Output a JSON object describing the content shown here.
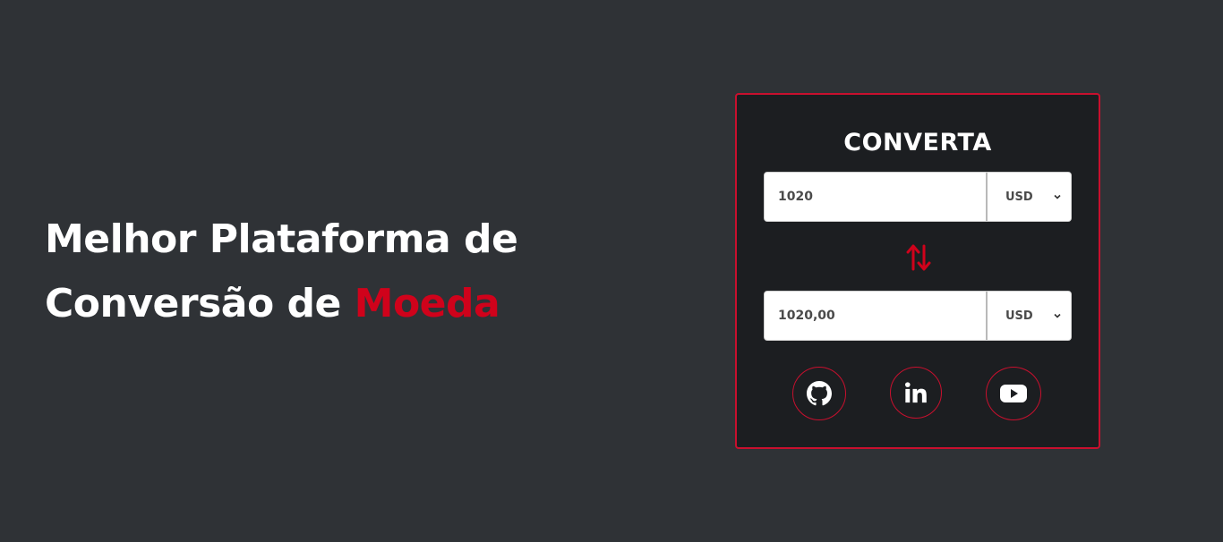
{
  "hero": {
    "line1": "Melhor Plataforma de",
    "line2_prefix": "Conversão de ",
    "line2_accent": "Moeda"
  },
  "converter": {
    "title": "CONVERTA",
    "from": {
      "value": "1020",
      "currency": "USD"
    },
    "to": {
      "value": "1020,00",
      "currency": "USD"
    },
    "swap_icon": "swap-vertical-arrows"
  },
  "social": [
    {
      "icon": "github-icon"
    },
    {
      "icon": "linkedin-icon"
    },
    {
      "icon": "youtube-icon"
    }
  ],
  "colors": {
    "background": "#2f3236",
    "card": "#1c1e21",
    "accent": "#d0021b",
    "border": "#c8102e"
  }
}
